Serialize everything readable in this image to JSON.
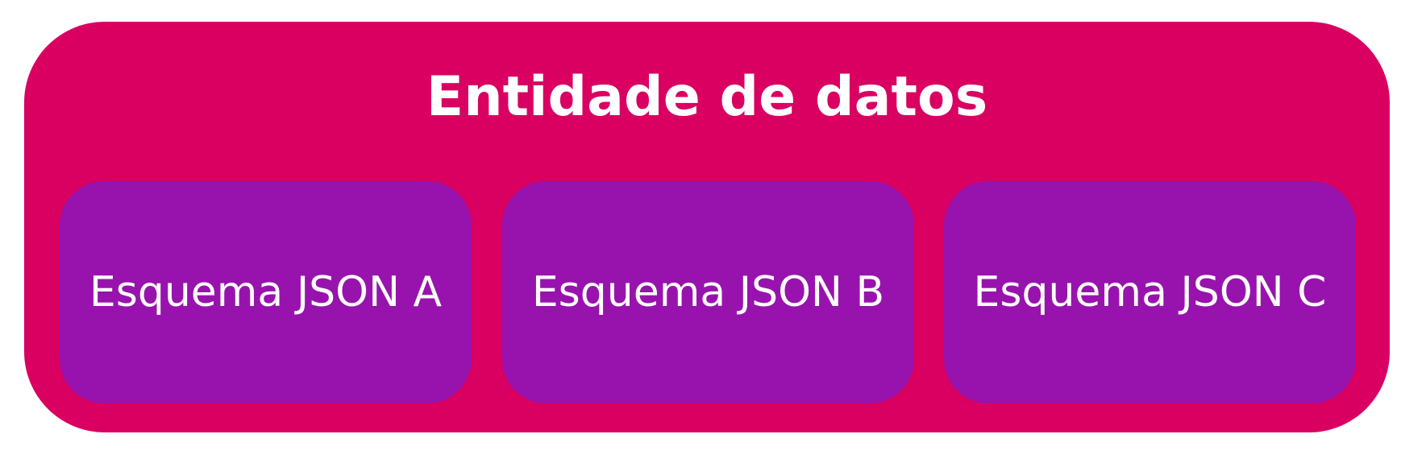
{
  "diagram": {
    "entity": {
      "title": "Entidade de datos",
      "color": "#d90062"
    },
    "schemas": [
      {
        "label": "Esquema JSON A",
        "color": "#9813ad"
      },
      {
        "label": "Esquema JSON B",
        "color": "#9813ad"
      },
      {
        "label": "Esquema JSON C",
        "color": "#9813ad"
      }
    ],
    "text_color": "#ffffff"
  }
}
